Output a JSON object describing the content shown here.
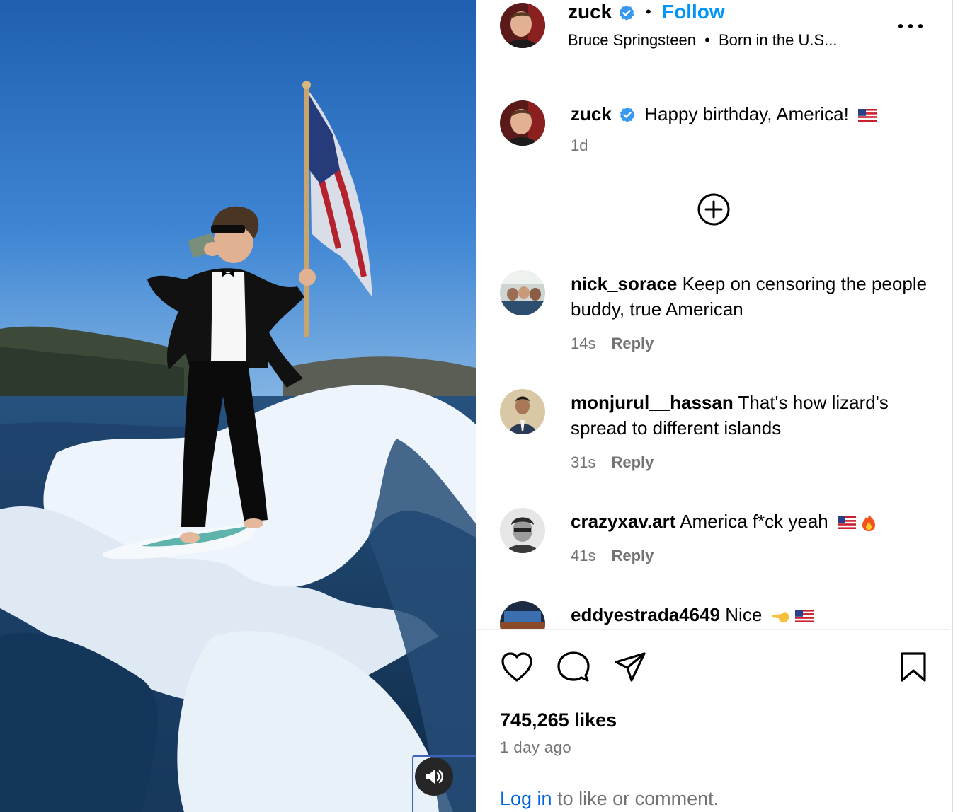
{
  "post": {
    "author": "zuck",
    "follow_label": "Follow",
    "separator": "•",
    "audio_artist": "Bruce Springsteen",
    "audio_track": "Born in the U.S...",
    "caption": "Happy birthday, America!",
    "caption_time": "1d",
    "likes": "745,265 likes",
    "date": "1 day ago"
  },
  "comments": [
    {
      "user": "nick_sorace",
      "text": "Keep on censoring the people buddy, true American",
      "time": "14s",
      "reply_label": "Reply"
    },
    {
      "user": "monjurul__hassan",
      "text": "That's how lizard's spread to different islands",
      "time": "31s",
      "reply_label": "Reply"
    },
    {
      "user": "crazyxav.art",
      "text": "America f*ck yeah",
      "time": "41s",
      "reply_label": "Reply"
    },
    {
      "user": "eddyestrada4649",
      "text": "Nice"
    }
  ],
  "footer": {
    "login_link": "Log in",
    "login_text": " to like or comment."
  },
  "icons": {
    "verified": "verified-badge-icon",
    "more": "more-options-icon",
    "load_more": "plus-circle-icon",
    "like": "heart-icon",
    "comment": "comment-bubble-icon",
    "share": "paper-plane-icon",
    "save": "bookmark-icon",
    "mute": "speaker-icon"
  },
  "colors": {
    "follow": "#0095f6",
    "verified": "#3897f0",
    "secondary_text": "#737373",
    "login_link": "#0064e0"
  }
}
